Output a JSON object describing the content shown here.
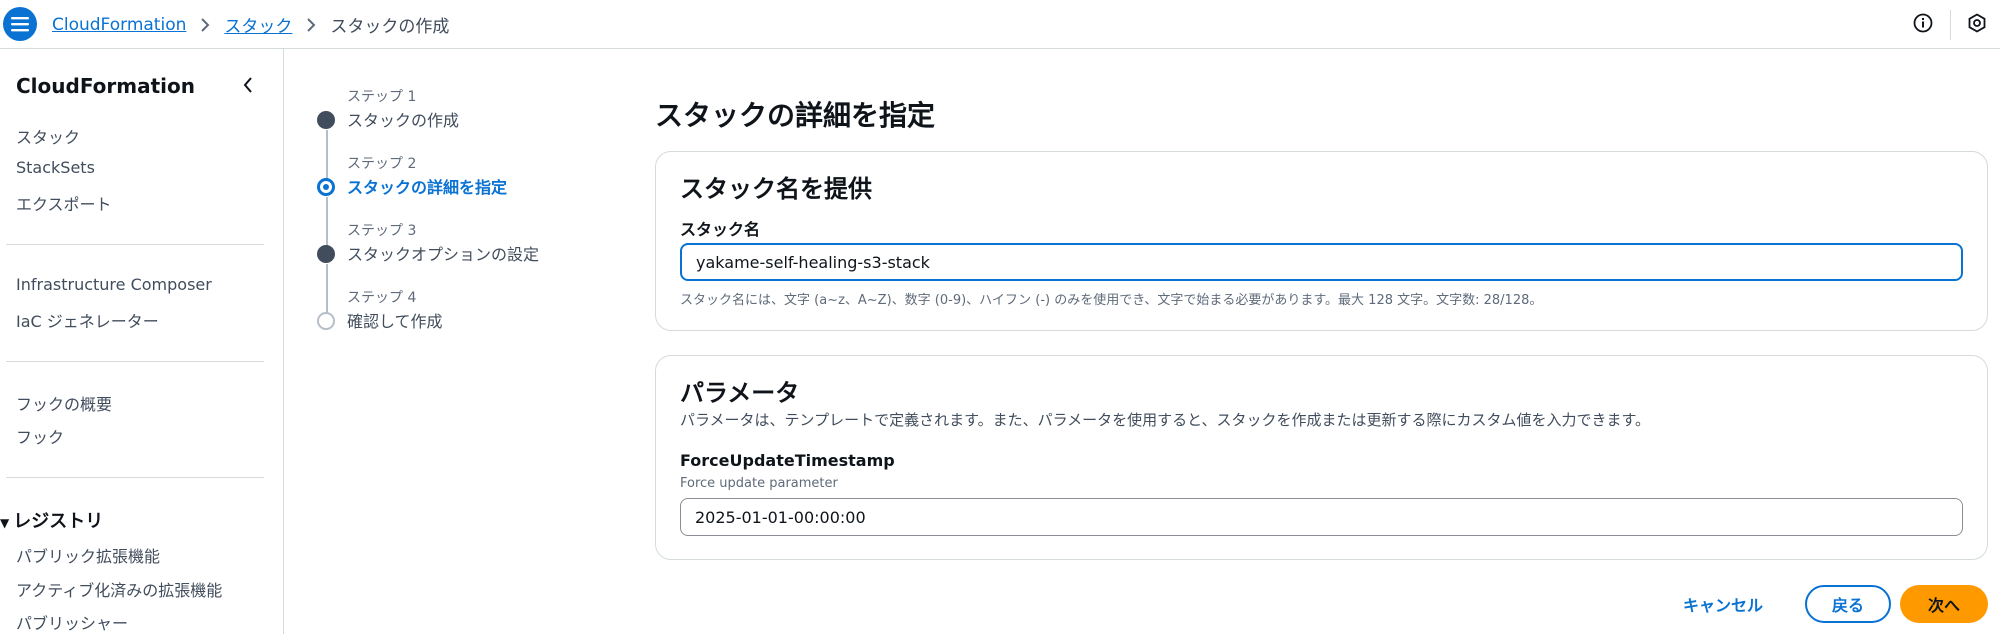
{
  "header": {
    "breadcrumbs": [
      "CloudFormation",
      "スタック",
      "スタックの作成"
    ]
  },
  "sidebar": {
    "title": "CloudFormation",
    "items_group1": [
      "スタック",
      "StackSets",
      "エクスポート"
    ],
    "items_group2": [
      "Infrastructure Composer",
      "IaC ジェネレーター"
    ],
    "items_group3": [
      "フックの概要",
      "フック"
    ],
    "registry_title": "レジストリ",
    "items_registry": [
      "パブリック拡張機能",
      "アクティブ化済みの拡張機能",
      "パブリッシャー"
    ]
  },
  "steps": [
    {
      "num": "ステップ 1",
      "title": "スタックの作成",
      "state": "done"
    },
    {
      "num": "ステップ 2",
      "title": "スタックの詳細を指定",
      "state": "active"
    },
    {
      "num": "ステップ 3",
      "title": "スタックオプションの設定",
      "state": "done"
    },
    {
      "num": "ステップ 4",
      "title": "確認して作成",
      "state": "todo"
    }
  ],
  "main": {
    "title": "スタックの詳細を指定",
    "stack_name_panel": {
      "title": "スタック名を提供",
      "label": "スタック名",
      "value": "yakame-self-healing-s3-stack",
      "hint": "スタック名には、文字 (a~z、A~Z)、数字 (0-9)、ハイフン (-) のみを使用でき、文字で始まる必要があります。最大 128 文字。文字数:   28/128。"
    },
    "parameters_panel": {
      "title": "パラメータ",
      "description": "パラメータは、テンプレートで定義されます。また、パラメータを使用すると、スタックを作成または更新する際にカスタム値を入力できます。",
      "param_label": "ForceUpdateTimestamp",
      "param_desc": "Force update parameter",
      "param_value": "2025-01-01-00:00:00"
    }
  },
  "footer": {
    "cancel": "キャンセル",
    "back": "戻る",
    "next": "次へ"
  },
  "colors": {
    "accent": "#0972d3",
    "primary_button": "#ff9900"
  }
}
